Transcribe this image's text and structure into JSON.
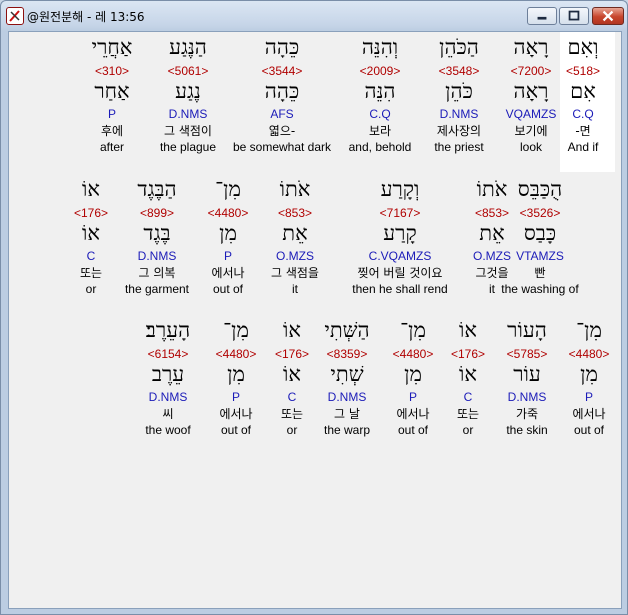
{
  "window": {
    "title": "@원전분해 - 레 13:56",
    "icon": "app-icon",
    "controls": [
      "minimize-icon",
      "maximize-icon",
      "close-icon"
    ]
  },
  "rows": [
    {
      "words": [
        {
          "heb": "וְאִם",
          "num": "<518>",
          "lex": "אִם",
          "morph": "C.Q",
          "ko": "-면",
          "en": "And if",
          "selected": true
        },
        {
          "heb": "רָאָה",
          "num": "<7200>",
          "lex": "רָאָה",
          "morph": "VQAMZS",
          "ko": "보기에",
          "en": "look"
        },
        {
          "heb": "הַכֹּהֵן",
          "num": "<3548>",
          "lex": "כֹּהֵן",
          "morph": "D.NMS",
          "ko": "제사장의",
          "en": "the priest"
        },
        {
          "heb": "וְהִנֵּה",
          "num": "<2009>",
          "lex": "הִנֵּה",
          "morph": "C.Q",
          "ko": "보라",
          "en": "and, behold"
        },
        {
          "heb": "כֵּהָה",
          "num": "<3544>",
          "lex": "כֵּהָה",
          "morph": "AFS",
          "ko": "엷으-",
          "en": "be somewhat dark"
        },
        {
          "heb": "הַנֶּגַע",
          "num": "<5061>",
          "lex": "נֶגַע",
          "morph": "D.NMS",
          "ko": "그 색점이",
          "en": "the plague"
        },
        {
          "heb": "אַחֲרֵי",
          "num": "<310>",
          "lex": "אַחַר",
          "morph": "P",
          "ko": "후에",
          "en": "after"
        }
      ]
    },
    {
      "words": [
        {
          "heb": "הֻכַּבֵּס",
          "num": "<3526>",
          "lex": "כָּבַס",
          "morph": "VTAMZS",
          "ko": "빤",
          "en": "the washing of"
        },
        {
          "heb": "אֹתוֹ",
          "num": "<853>",
          "lex": "אֵת",
          "morph": "O.MZS",
          "ko": "그것을",
          "en": "it"
        },
        {
          "heb": "וְקָרַע",
          "num": "<7167>",
          "lex": "קָרַע",
          "morph": "C.VQAMZS",
          "ko": "찢어 버릴 것이요",
          "en": "then he shall rend"
        },
        {
          "heb": "אֹתוֹ",
          "num": "<853>",
          "lex": "אֵת",
          "morph": "O.MZS",
          "ko": "그 색점을",
          "en": "it"
        },
        {
          "heb": "מִן־",
          "num": "<4480>",
          "lex": "מִן",
          "morph": "P",
          "ko": "에서나",
          "en": "out of"
        },
        {
          "heb": "הַבֶּגֶד",
          "num": "<899>",
          "lex": "בֶּגֶד",
          "morph": "D.NMS",
          "ko": "그 의복",
          "en": "the garment"
        },
        {
          "heb": "אוֹ",
          "num": "<176>",
          "lex": "אוֹ",
          "morph": "C",
          "ko": "또는",
          "en": "or"
        }
      ]
    },
    {
      "words": [
        {
          "heb": "מִן־",
          "num": "<4480>",
          "lex": "מִן",
          "morph": "P",
          "ko": "에서나",
          "en": "out of"
        },
        {
          "heb": "הָעוֹר",
          "num": "<5785>",
          "lex": "עוֹר",
          "morph": "D.NMS",
          "ko": "가죽",
          "en": "the skin"
        },
        {
          "heb": "אוֹ",
          "num": "<176>",
          "lex": "אוֹ",
          "morph": "C",
          "ko": "또는",
          "en": "or"
        },
        {
          "heb": "מִן־",
          "num": "<4480>",
          "lex": "מִן",
          "morph": "P",
          "ko": "에서나",
          "en": "out of"
        },
        {
          "heb": "הַשְּׁתִי",
          "num": "<8359>",
          "lex": "שְׁתִי",
          "morph": "D.NMS",
          "ko": "그 날",
          "en": "the warp"
        },
        {
          "heb": "אוֹ",
          "num": "<176>",
          "lex": "אוֹ",
          "morph": "C",
          "ko": "또는",
          "en": "or"
        },
        {
          "heb": "מִן־",
          "num": "<4480>",
          "lex": "מִן",
          "morph": "P",
          "ko": "에서나",
          "en": "out of"
        },
        {
          "heb": "הָעֵרֶב׃",
          "num": "<6154>",
          "lex": "עֵרֶב",
          "morph": "D.NMS",
          "ko": "씨",
          "en": "the woof"
        }
      ]
    }
  ]
}
